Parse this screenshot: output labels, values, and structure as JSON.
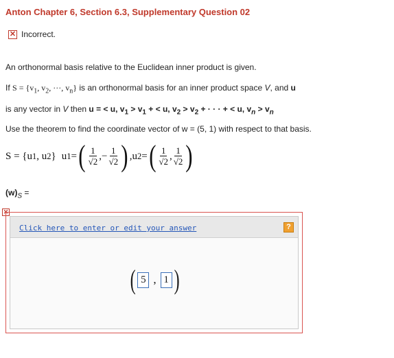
{
  "header": {
    "title": "Anton Chapter 6, Section 6.3, Supplementary Question 02"
  },
  "status": {
    "icon": "x-mark-icon",
    "text": "Incorrect."
  },
  "problem": {
    "line1": "An orthonormal basis relative to the Euclidean inner product is given.",
    "line2_a": "If ",
    "line2_set": "S = {v",
    "line2_set_mid": ", v",
    "line2_set_end": ", ···, v",
    "line2_set_close": "}",
    "line2_b": " is an orthonormal basis for an inner product space ",
    "line2_V": "V",
    "line2_c": ", and ",
    "line2_u": "u",
    "line3_a": "is any vector in ",
    "line3_V": "V",
    "line3_b": " then ",
    "line3_expr": "u = < u, v",
    "line3_expr2": " > v",
    "line3_expr3": " + < u, v",
    "line3_expr4": " > v",
    "line3_expr5": " + · · · + < u, v",
    "line3_expr6": " > v",
    "line4": "Use the theorem to find the coordinate vector of w = (5, 1) with respect to that basis."
  },
  "math": {
    "set": "S = {u",
    "set_mid": ", u",
    "set_close": "}",
    "u1": "u",
    "u1_eq": " =",
    "minus": "−",
    "u2": "u",
    "u2_eq": "=",
    "one": "1",
    "root2": "√2",
    "sub1": "1",
    "sub2": "2",
    "subn": "n"
  },
  "prompt": {
    "label": "(w)",
    "sub": "S",
    "eq": " ="
  },
  "answer": {
    "link_text": "Click here to enter or edit your answer",
    "help": "?",
    "values": [
      "5",
      "1"
    ]
  },
  "colors": {
    "title": "#c0392b",
    "error": "#c0392b",
    "link": "#2456b8",
    "help": "#f0a030"
  }
}
